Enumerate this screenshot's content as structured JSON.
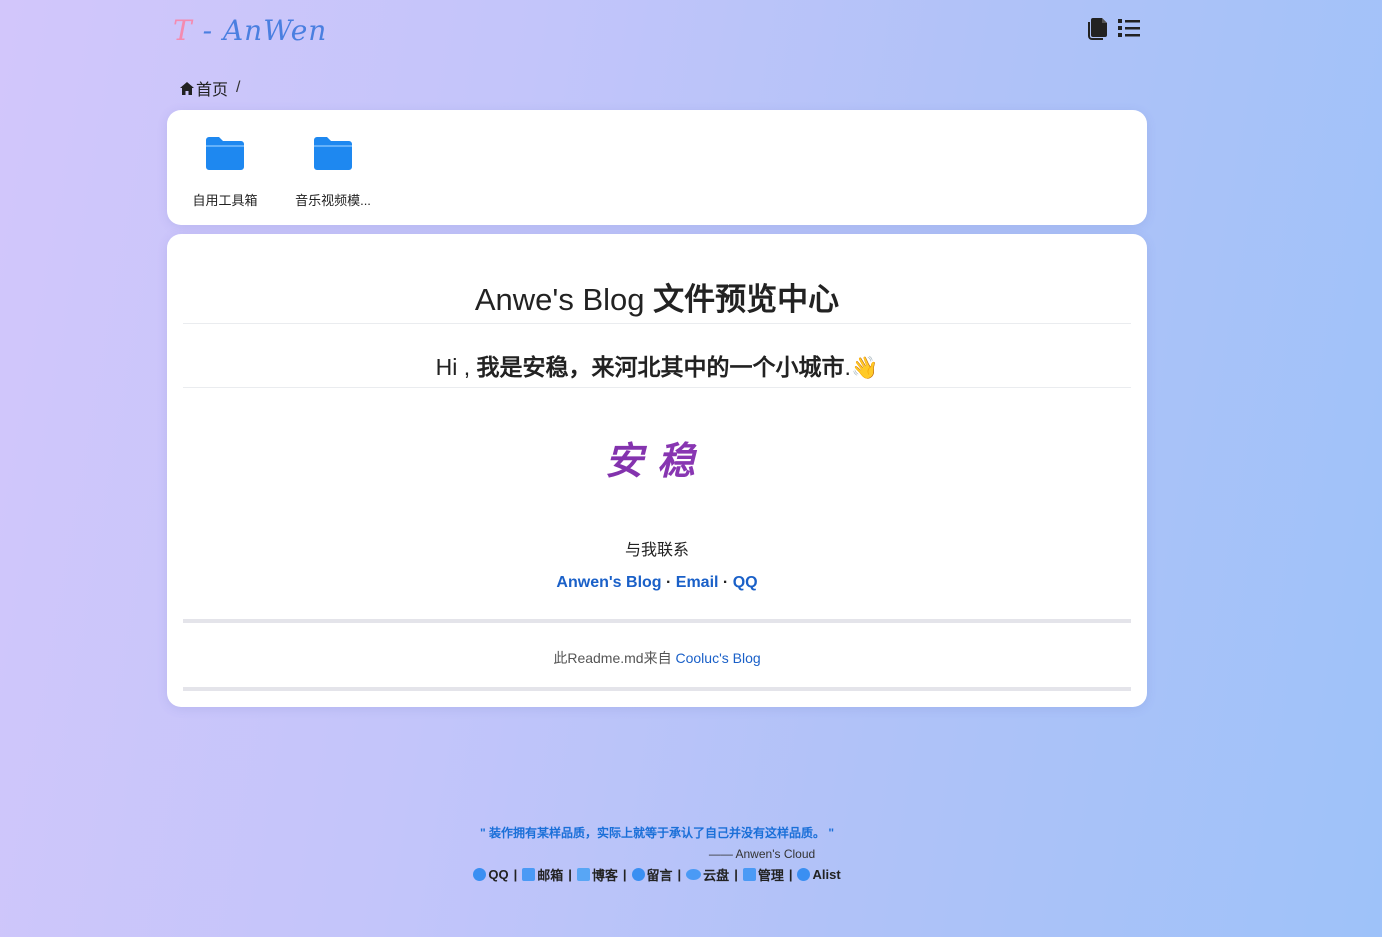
{
  "header": {
    "logo_t": "T",
    "logo_dash": " - ",
    "logo_name": "AnWen",
    "icons": [
      "files-icon",
      "list-icon"
    ]
  },
  "breadcrumb": {
    "home": "首页",
    "separator": "/"
  },
  "files": [
    {
      "name": "自用工具箱",
      "icon": "folder-icon"
    },
    {
      "name": "音乐视频模...",
      "icon": "folder-icon"
    }
  ],
  "readme": {
    "title_plain": "Anwe's Blog ",
    "title_bold": "文件预览中心",
    "intro_plain": "Hi , ",
    "intro_bold": "我是安稳，来河北其中的一个小城市",
    "intro_end": ".",
    "intro_emoji": "👋",
    "signature": "安稳",
    "contact_title": "与我联系",
    "links": [
      "Anwen's Blog",
      "Email",
      "QQ"
    ],
    "link_sep": " · ",
    "source_prefix": "此Readme.md来自 ",
    "source_link": "Cooluc's Blog"
  },
  "footer": {
    "quote": "\" 装作拥有某样品质，实际上就等于承认了自己并没有这样品质。 \"",
    "author": "—— Anwen's Cloud",
    "links": [
      {
        "label": "QQ",
        "icon": "qq-icon"
      },
      {
        "label": "邮箱",
        "icon": "mail-icon"
      },
      {
        "label": "博客",
        "icon": "edit-icon"
      },
      {
        "label": "留言",
        "icon": "message-icon"
      },
      {
        "label": "云盘",
        "icon": "cloud-icon"
      },
      {
        "label": "管理",
        "icon": "manage-icon"
      },
      {
        "label": "Alist",
        "icon": "alist-icon"
      }
    ],
    "sep": "|"
  },
  "colors": {
    "accent": "#1a60c8",
    "folder": "#1e88f0",
    "quote": "#1a6fd8",
    "logo_pink": "#f48bb0",
    "logo_blue": "#4a7fe0"
  }
}
